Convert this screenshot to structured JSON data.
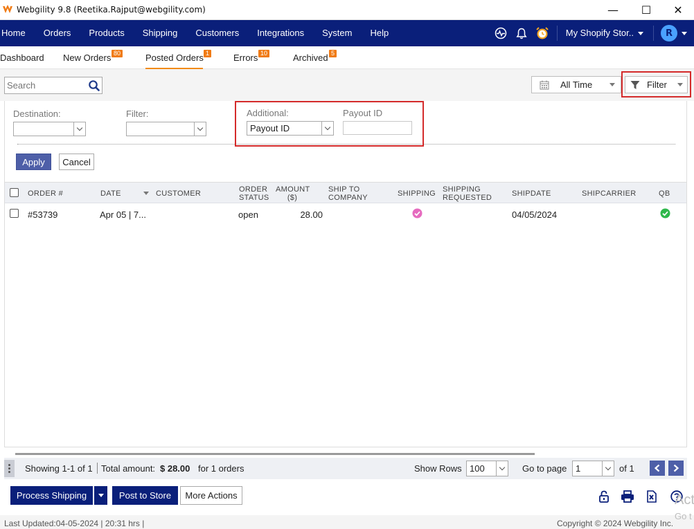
{
  "window": {
    "title": "Webgility 9.8 (Reetika.Rajput@webgility.com)",
    "controls": {
      "minimize": "—",
      "maximize": "☐",
      "close": "✕"
    }
  },
  "nav": {
    "items": [
      "Home",
      "Orders",
      "Products",
      "Shipping",
      "Customers",
      "Integrations",
      "System",
      "Help"
    ],
    "store_label": "My Shopify Stor..",
    "avatar_initial": "R",
    "icons": [
      "activity-icon",
      "bell-icon",
      "alarm-clock-icon"
    ]
  },
  "tabs": [
    {
      "label": "Dashboard",
      "badge": ""
    },
    {
      "label": "New Orders",
      "badge": "80"
    },
    {
      "label": "Posted Orders",
      "badge": "1"
    },
    {
      "label": "Errors",
      "badge": "10"
    },
    {
      "label": "Archived",
      "badge": "5"
    }
  ],
  "toolbar": {
    "search_placeholder": "Search",
    "date_range": "All Time",
    "filter_label": "Filter"
  },
  "filters": {
    "destination_label": "Destination:",
    "destination_value": "",
    "filter_label": "Filter:",
    "filter_value": "",
    "additional_label": "Additional:",
    "additional_value": "Payout ID",
    "payout_label": "Payout ID",
    "payout_value": "",
    "apply_label": "Apply",
    "cancel_label": "Cancel"
  },
  "table": {
    "headers": {
      "order": "ORDER #",
      "date": "DATE",
      "customer": "CUSTOMER",
      "status_1": "ORDER",
      "status_2": "STATUS",
      "amount_1": "AMOUNT",
      "amount_2": "($)",
      "ship_to_1": "SHIP TO",
      "ship_to_2": "COMPANY",
      "shipping": "SHIPPING",
      "ship_req_1": "SHIPPING",
      "ship_req_2": "REQUESTED",
      "shipdate": "SHIPDATE",
      "shipcarrier": "SHIPCARRIER",
      "qb": "QB"
    },
    "rows": [
      {
        "order": "#53739",
        "date": "Apr 05 | 7...",
        "customer": "",
        "status": "open",
        "amount": "28.00",
        "ship_to": "",
        "shipping_status": "pink-check",
        "ship_requested": "",
        "shipdate": "04/05/2024",
        "shipcarrier": "",
        "qb_status": "green-check"
      }
    ]
  },
  "summary": {
    "showing": "Showing 1-1 of 1",
    "total_label": "Total amount:",
    "total_value": "$ 28.00",
    "orders_suffix": "for 1 orders",
    "show_rows_label": "Show Rows",
    "show_rows_value": "100",
    "goto_label": "Go to page",
    "goto_value": "1",
    "of_pages": "of 1"
  },
  "actions": {
    "process_shipping": "Process Shipping",
    "post_to_store": "Post to Store",
    "more_actions": "More Actions"
  },
  "status": {
    "last_updated": "Last Updated:04-05-2024 | 20:31 hrs |",
    "copyright": "Copyright © 2024 Webgility Inc."
  },
  "watermark": {
    "line1": "Act",
    "line2": "Go t"
  },
  "colors": {
    "nav_bg": "#0a1f7a",
    "badge": "#f07b15",
    "active_tab_underline": "#f28a16",
    "highlight": "#d42a2a",
    "apply_btn": "#4e5fa8",
    "success": "#2eb84b",
    "shipping_check": "#e66bbf"
  }
}
